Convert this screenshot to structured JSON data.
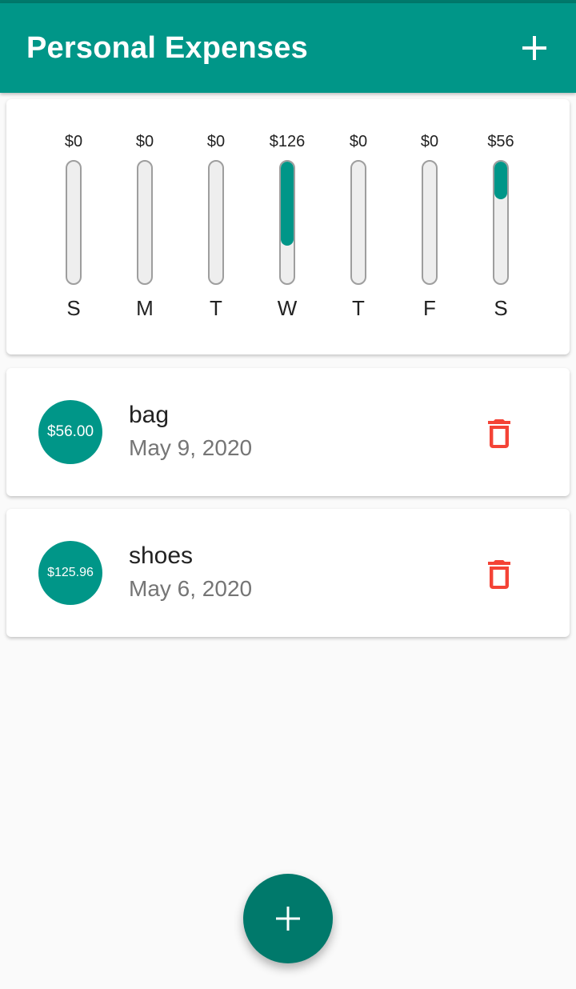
{
  "appbar": {
    "title": "Personal Expenses",
    "add_icon": "plus-icon"
  },
  "chart_data": {
    "type": "bar",
    "categories": [
      "S",
      "M",
      "T",
      "W",
      "T",
      "F",
      "S"
    ],
    "value_labels": [
      "$0",
      "$0",
      "$0",
      "$126",
      "$0",
      "$0",
      "$56"
    ],
    "values": [
      0,
      0,
      0,
      125.96,
      0,
      0,
      56
    ],
    "fill_fraction": [
      0,
      0,
      0,
      0.69,
      0,
      0,
      0.31
    ],
    "color": "#009688"
  },
  "transactions": [
    {
      "amount": "$56.00",
      "title": "bag",
      "date": "May 9, 2020",
      "delete_icon": "trash-icon"
    },
    {
      "amount": "$125.96",
      "title": "shoes",
      "date": "May 6, 2020",
      "delete_icon": "trash-icon"
    }
  ],
  "colors": {
    "primary": "#009688",
    "primary_dark": "#00796b",
    "delete": "#f44336"
  },
  "fab": {
    "icon": "plus-icon"
  }
}
